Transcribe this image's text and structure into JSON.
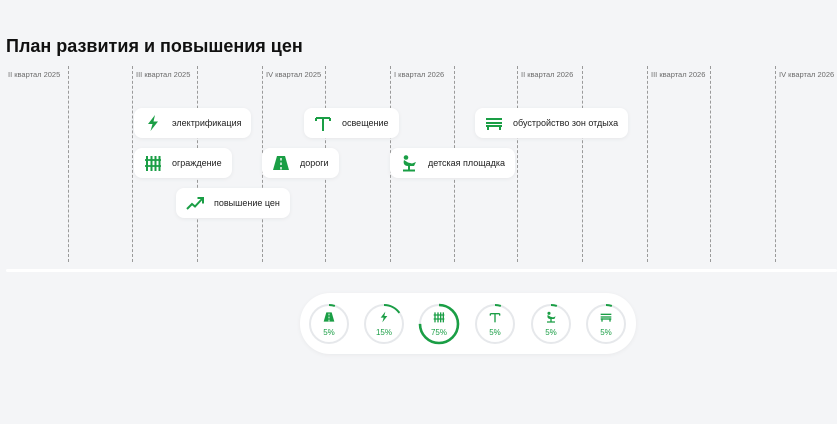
{
  "page": {
    "title": "План развития и повышения цен"
  },
  "colors": {
    "accent": "#1a9e45",
    "ring_track": "#e6e8eb",
    "background": "#f4f5f7"
  },
  "timeline": {
    "quarters": [
      {
        "label": "II квартал 2025"
      },
      {
        "label": "III квартал 2025"
      },
      {
        "label": "IV квартал 2025"
      },
      {
        "label": "I квартал 2026"
      },
      {
        "label": "II квартал 2026"
      },
      {
        "label": "III квартал 2026"
      },
      {
        "label": "IV квартал 2026"
      }
    ]
  },
  "events": [
    {
      "label": "электрификация",
      "icon": "lightning-icon"
    },
    {
      "label": "освещение",
      "icon": "street-lamp-icon"
    },
    {
      "label": "обустройство зон отдыха",
      "icon": "bench-icon"
    },
    {
      "label": "ограждение",
      "icon": "fence-icon"
    },
    {
      "label": "дороги",
      "icon": "road-icon"
    },
    {
      "label": "детская площадка",
      "icon": "playground-icon"
    },
    {
      "label": "повышение цен",
      "icon": "trend-up-icon"
    }
  ],
  "progress": [
    {
      "icon": "road-icon",
      "percent_label": "5%",
      "value": 5
    },
    {
      "icon": "lightning-icon",
      "percent_label": "15%",
      "value": 15
    },
    {
      "icon": "fence-icon",
      "percent_label": "75%",
      "value": 75
    },
    {
      "icon": "street-lamp-icon",
      "percent_label": "5%",
      "value": 5
    },
    {
      "icon": "playground-icon",
      "percent_label": "5%",
      "value": 5
    },
    {
      "icon": "bench-icon",
      "percent_label": "5%",
      "value": 5
    }
  ]
}
